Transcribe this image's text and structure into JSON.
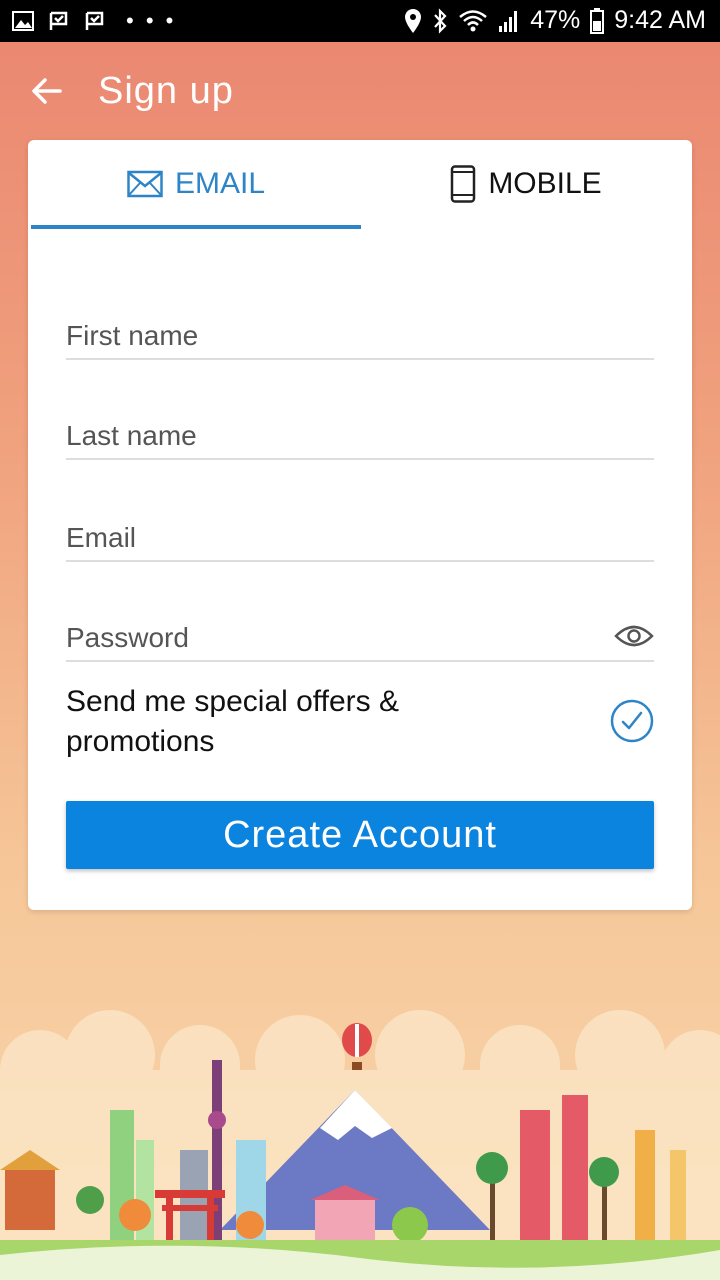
{
  "status_bar": {
    "dots": "• • •",
    "battery": "47%",
    "time": "9:42 AM"
  },
  "header": {
    "title": "Sign up"
  },
  "tabs": [
    {
      "label": "EMAIL",
      "icon": "envelope-icon",
      "active": true
    },
    {
      "label": "MOBILE",
      "icon": "phone-icon",
      "active": false
    }
  ],
  "form": {
    "first_name_placeholder": "First name",
    "last_name_placeholder": "Last name",
    "email_placeholder": "Email",
    "password_placeholder": "Password",
    "offers_label": "Send me special offers & promotions",
    "offers_checked": true,
    "submit_label": "Create Account"
  },
  "colors": {
    "accent": "#2d85c8",
    "button": "#0b84e0",
    "header_bg_top": "#ea8570"
  }
}
